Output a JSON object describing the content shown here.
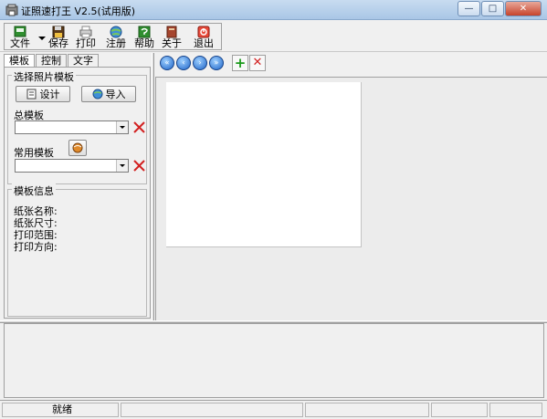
{
  "window": {
    "title": "证照速打王 V2.5(试用版)",
    "minimize_glyph": "—",
    "maximize_glyph": "□",
    "close_glyph": "✕"
  },
  "toolbar": {
    "items": [
      {
        "label": "文件",
        "icon": "file-icon"
      },
      {
        "label": "保存",
        "icon": "save-icon"
      },
      {
        "label": "打印",
        "icon": "printer-icon"
      },
      {
        "label": "注册",
        "icon": "globe-icon"
      },
      {
        "label": "帮助",
        "icon": "help-icon"
      },
      {
        "label": "关于",
        "icon": "book-icon"
      },
      {
        "label": "退出",
        "icon": "exit-icon"
      }
    ]
  },
  "left_panel": {
    "tabs": [
      {
        "label": "模板",
        "active": true
      },
      {
        "label": "控制",
        "active": false
      },
      {
        "label": "文字",
        "active": false
      }
    ],
    "select_group": {
      "legend": "选择照片模板",
      "design_button": "设计",
      "import_button": "导入",
      "total_template_label": "总模板",
      "total_template_value": "",
      "common_template_label": "常用模板",
      "common_template_value": ""
    },
    "info_group": {
      "legend": "模板信息",
      "lines": [
        "纸张名称:",
        "纸张尺寸:",
        "打印范围:",
        "打印方向:"
      ]
    }
  },
  "nav": {
    "first_glyph": "«",
    "prev_glyph": "‹",
    "next_glyph": "›",
    "last_glyph": "»",
    "add_glyph": "+",
    "delete_glyph": "✕"
  },
  "status": {
    "message": "就绪"
  },
  "colors": {
    "title_bar": "#a9c6e6",
    "delete_red": "#d22222",
    "add_green": "#1a9a1a",
    "nav_blue": "#1e64c8"
  }
}
